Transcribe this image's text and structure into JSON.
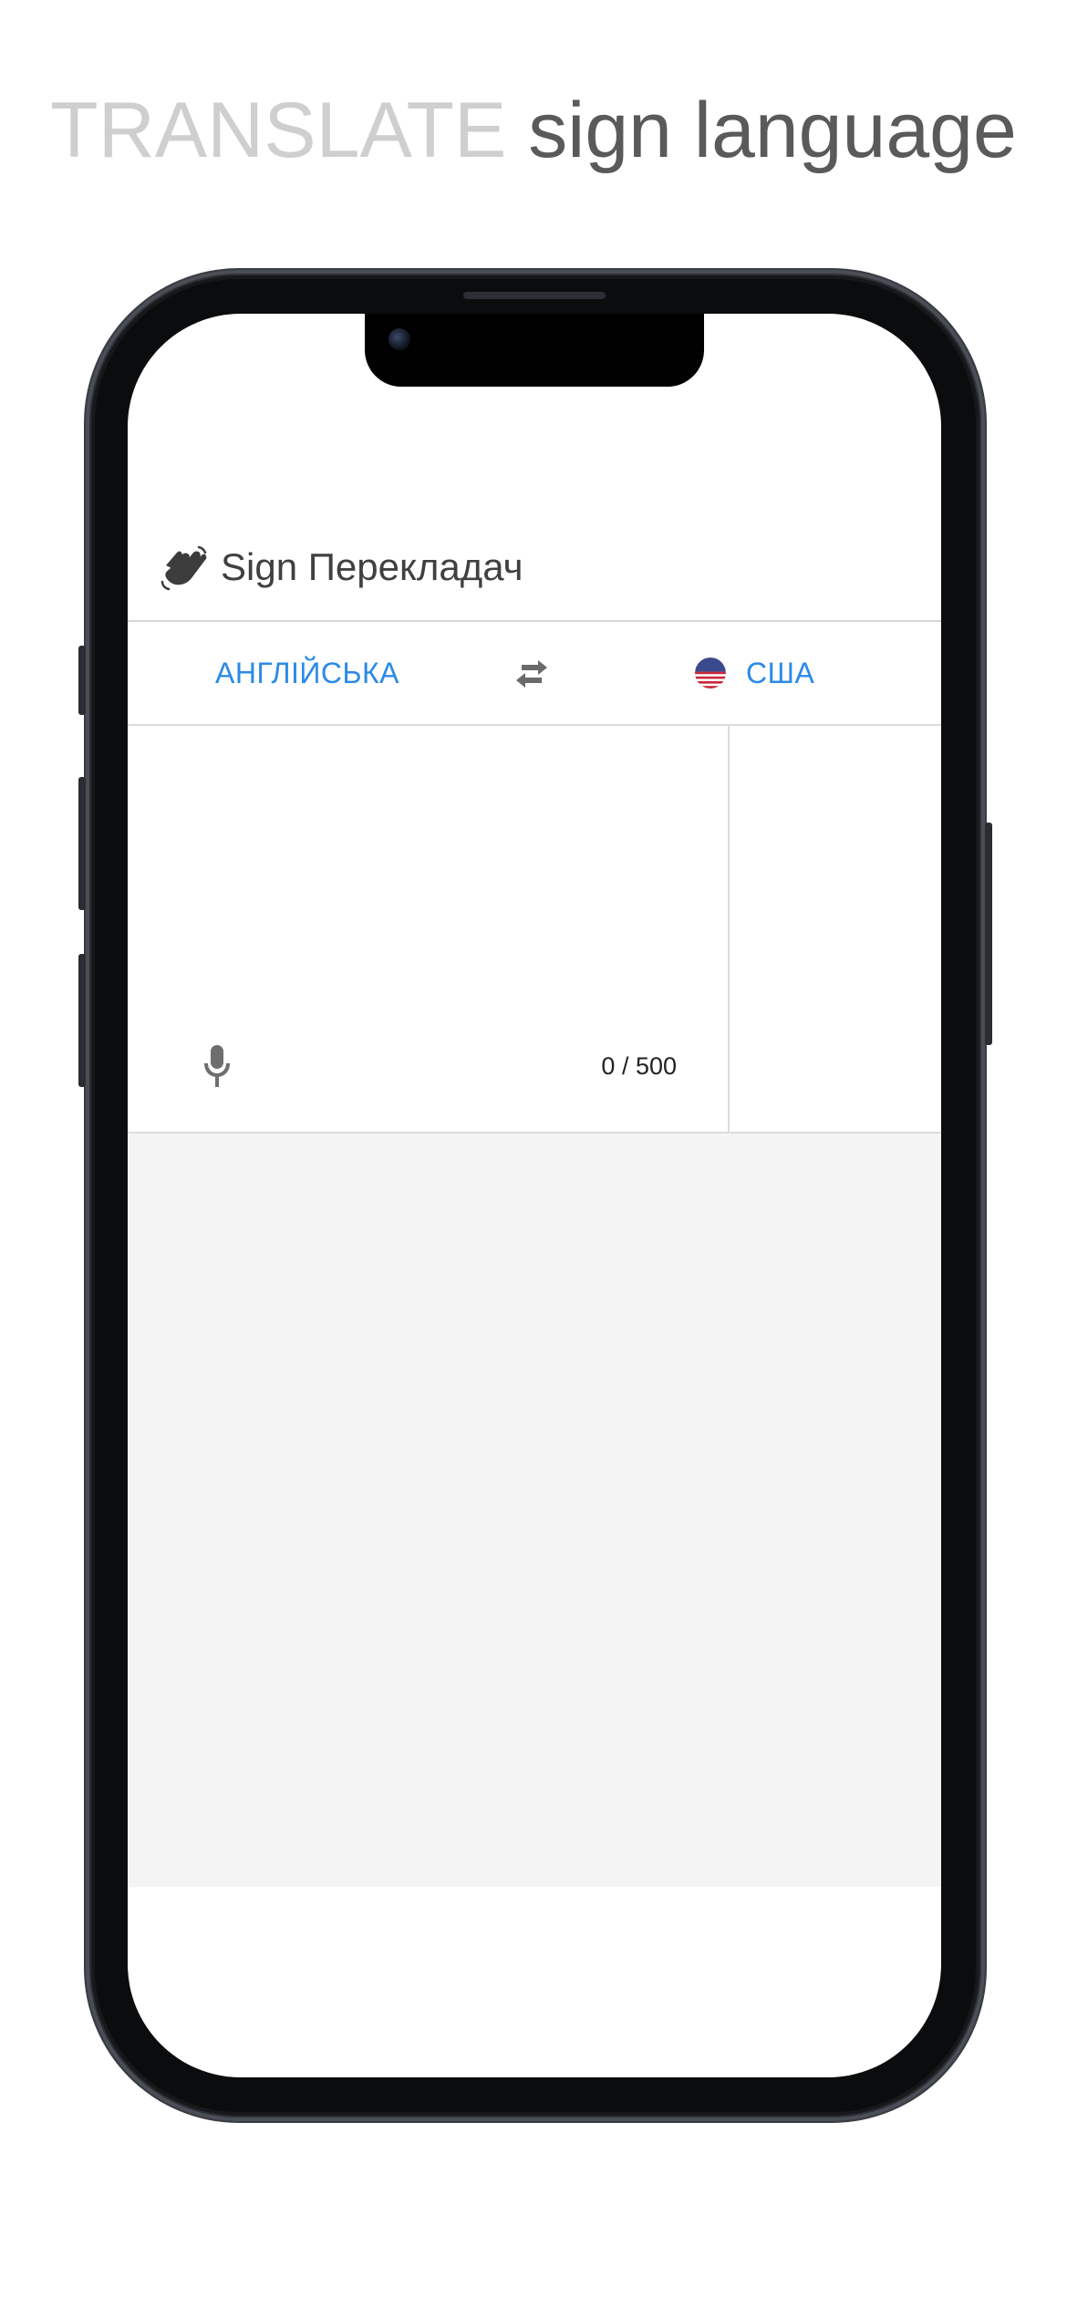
{
  "headline": {
    "part1": "TRANSLATE",
    "part2": "sign language"
  },
  "app": {
    "title": "Sign Перекладач",
    "logo_icon": "waving-hand-icon"
  },
  "language_bar": {
    "source_language": "АНГЛІЙСЬКА",
    "swap_icon": "swap-arrows-icon",
    "target_language": "США",
    "target_flag_icon": "us-flag-icon"
  },
  "input": {
    "value": "",
    "mic_icon": "microphone-icon",
    "char_count": "0 / 500"
  },
  "colors": {
    "accent": "#2b8ae6",
    "headline_light": "#cfcfcf",
    "headline_dark": "#5a5a5a",
    "video_background": "#f4f4f4"
  }
}
